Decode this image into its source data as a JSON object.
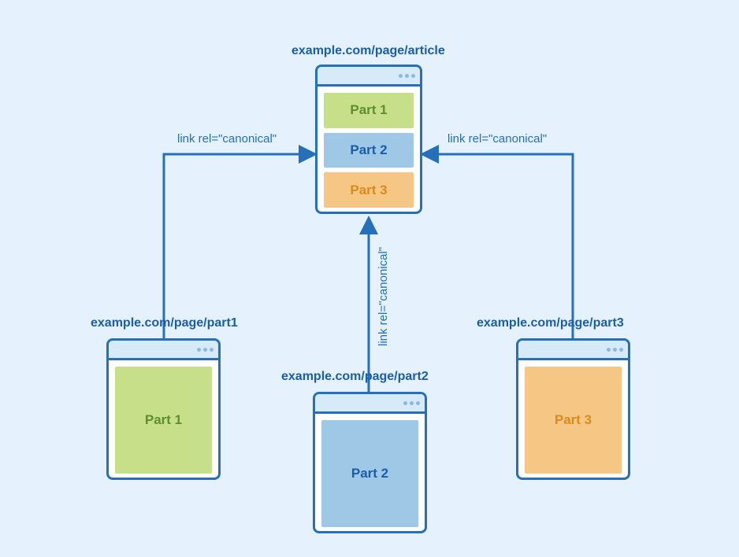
{
  "colors": {
    "accent": "#2570b8",
    "bg": "#e5f1fc",
    "green": "#c6df88",
    "blue": "#9ec8e6",
    "orange": "#f6c784"
  },
  "main": {
    "url": "example.com/page/article",
    "parts": [
      {
        "label": "Part 1",
        "color": "green"
      },
      {
        "label": "Part 2",
        "color": "blue"
      },
      {
        "label": "Part 3",
        "color": "orange"
      }
    ]
  },
  "children": [
    {
      "url": "example.com/page/part1",
      "label": "Part 1",
      "color": "green",
      "link_label": "link rel=\"canonical\""
    },
    {
      "url": "example.com/page/part2",
      "label": "Part 2",
      "color": "blue",
      "link_label": "link rel=\"canonical\""
    },
    {
      "url": "example.com/page/part3",
      "label": "Part 3",
      "color": "orange",
      "link_label": "link rel=\"canonical\""
    }
  ]
}
